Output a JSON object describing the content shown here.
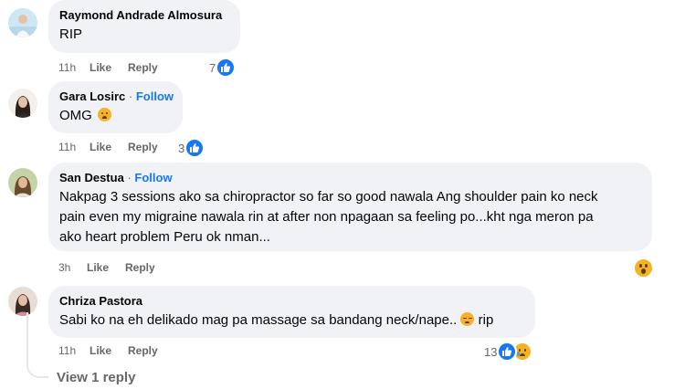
{
  "comments": [
    {
      "author": "Raymond Andrade Almosura",
      "follow": "",
      "text": "RIP",
      "time": "11h",
      "like": "Like",
      "reply": "Reply",
      "reaction_count": "7",
      "reactions": [
        "like-icon"
      ]
    },
    {
      "author": "Gara Losirc",
      "follow": "Follow",
      "text": "OMG",
      "time": "11h",
      "like": "Like",
      "reply": "Reply",
      "reaction_count": "3",
      "reactions": [
        "like-icon"
      ]
    },
    {
      "author": "San Destua",
      "follow": "Follow",
      "text_lines": [
        "Nakpag 3 sessions ako sa chiropractor so far so good nawala Ang shoulder pain ko neck",
        "pain even my migraine nawala rin at after non npagaan sa feeling po...kht nga meron pa",
        "ako heart problem Peru ok nman..."
      ],
      "time": "3h",
      "like": "Like",
      "reply": "Reply",
      "reactions": [
        "wow-emoji-icon"
      ]
    },
    {
      "author": "Chriza Pastora",
      "follow": "",
      "text": "Sabi ko na eh delikado mag pa massage sa bandang neck/nape..",
      "text_suffix": "rip",
      "time": "11h",
      "like": "Like",
      "reply": "Reply",
      "reaction_count": "13",
      "reactions": [
        "like-icon",
        "sad-emoji-icon"
      ]
    }
  ],
  "view_replies": "View 1 reply",
  "colors": {
    "accent": "#1877f2",
    "bubble": "#f0f2f5",
    "muted": "#65676b",
    "emoji": "#f7b125"
  }
}
